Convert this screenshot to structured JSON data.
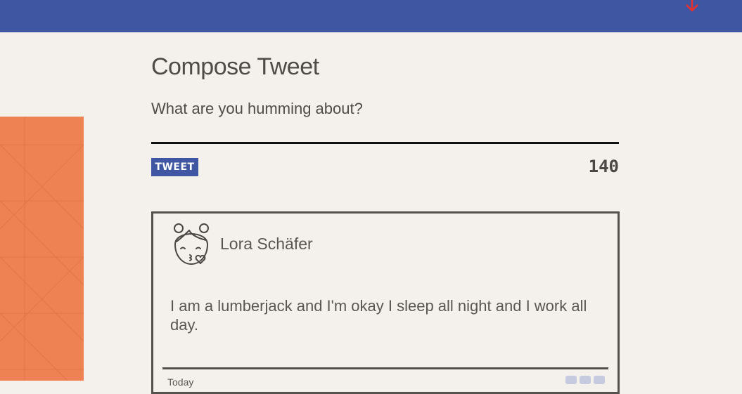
{
  "header": {
    "accent_color": "#3f56a2",
    "scroll_icon": "arrow-down-icon"
  },
  "compose": {
    "title": "Compose Tweet",
    "placeholder": "What are you humming about?",
    "button_label": "TWEET",
    "char_count": "140"
  },
  "tweet": {
    "avatar_icon": "girl-avatar-icon",
    "author": "Lora Schäfer",
    "text": "I am a lumberjack and I'm okay I sleep all night and I work all day.",
    "date": "Today",
    "action_icons": [
      "flag-icon",
      "retweet-icon",
      "heart-icon"
    ]
  },
  "colors": {
    "background": "#f4f1ec",
    "side_panel": "#ef8253",
    "text": "#4f4b48"
  }
}
